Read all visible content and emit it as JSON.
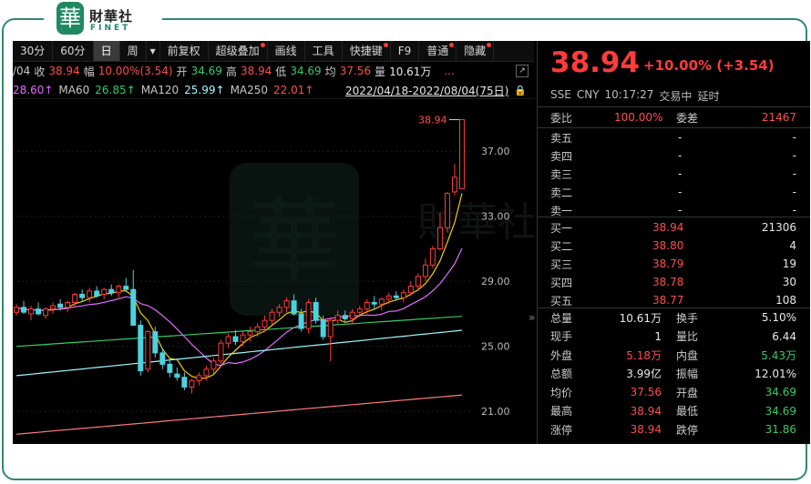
{
  "brand": {
    "badge": "華",
    "name": "財華社",
    "sub": "FINET"
  },
  "toolbar": {
    "items": [
      "30分",
      "60分",
      "日",
      "周",
      "▾",
      "前复权",
      "超级叠加",
      "画线",
      "工具",
      "快捷键",
      "F9",
      "普通",
      "隐藏"
    ],
    "active": "日"
  },
  "quote": {
    "date": "/04",
    "close_label": "收",
    "close": "38.94",
    "range_label": "幅",
    "range": "10.00%(3.54)",
    "open_label": "开",
    "open": "34.69",
    "high_label": "高",
    "high": "38.94",
    "low_label": "低",
    "low": "34.69",
    "avg_label": "均",
    "avg": "37.56",
    "vol_label": "量",
    "vol": "10.61万",
    "more": "..."
  },
  "ma": {
    "ma_first": "28.60↑",
    "ma60_label": "MA60",
    "ma60": "26.85↑",
    "ma120_label": "MA120",
    "ma120": "25.99↑",
    "ma250_label": "MA250",
    "ma250": "22.01↑",
    "date_range": "2022/04/18-2022/08/04(75日)"
  },
  "chart_data": {
    "type": "candlestick",
    "y_ticks": [
      "37.00",
      "33.00",
      "29.00",
      "25.00",
      "21.00"
    ],
    "ylim": [
      19.0,
      40.2
    ],
    "last_price_label": "38.94",
    "candles": [
      [
        27.1,
        27.6,
        26.9,
        27.4
      ],
      [
        27.4,
        27.8,
        27.0,
        27.1
      ],
      [
        27.0,
        27.5,
        26.6,
        27.3
      ],
      [
        27.3,
        27.7,
        26.9,
        27.0
      ],
      [
        26.9,
        27.4,
        26.7,
        27.3
      ],
      [
        27.3,
        27.7,
        27.0,
        27.5
      ],
      [
        27.6,
        27.9,
        27.2,
        27.4
      ],
      [
        27.4,
        27.8,
        27.1,
        27.7
      ],
      [
        27.7,
        28.3,
        27.4,
        28.2
      ],
      [
        28.2,
        28.5,
        27.8,
        28.0
      ],
      [
        28.0,
        28.6,
        27.7,
        28.4
      ],
      [
        28.4,
        28.7,
        28.0,
        28.1
      ],
      [
        28.2,
        28.6,
        27.9,
        28.5
      ],
      [
        28.5,
        28.8,
        28.1,
        28.3
      ],
      [
        28.3,
        28.8,
        28.0,
        28.7
      ],
      [
        28.7,
        29.2,
        28.4,
        28.5
      ],
      [
        28.5,
        29.7,
        28.2,
        26.3
      ],
      [
        26.3,
        26.6,
        23.2,
        23.5
      ],
      [
        23.6,
        26.0,
        23.4,
        25.9
      ],
      [
        25.9,
        26.2,
        24.3,
        24.6
      ],
      [
        24.6,
        24.9,
        23.6,
        23.9
      ],
      [
        23.9,
        24.3,
        23.1,
        23.4
      ],
      [
        23.3,
        23.7,
        22.9,
        23.1
      ],
      [
        23.1,
        23.4,
        22.3,
        22.5
      ],
      [
        22.5,
        23.0,
        22.1,
        22.9
      ],
      [
        22.9,
        23.4,
        22.6,
        23.2
      ],
      [
        23.2,
        23.8,
        22.9,
        23.6
      ],
      [
        23.6,
        24.3,
        23.3,
        24.1
      ],
      [
        24.1,
        25.4,
        23.9,
        25.2
      ],
      [
        25.2,
        25.8,
        24.9,
        25.6
      ],
      [
        25.6,
        26.0,
        25.1,
        25.3
      ],
      [
        25.3,
        25.9,
        25.0,
        25.7
      ],
      [
        25.7,
        26.2,
        25.3,
        25.9
      ],
      [
        25.9,
        26.4,
        25.6,
        26.2
      ],
      [
        26.2,
        26.9,
        25.9,
        26.6
      ],
      [
        26.6,
        27.3,
        26.3,
        27.1
      ],
      [
        27.1,
        27.6,
        26.8,
        27.4
      ],
      [
        27.4,
        28.0,
        27.1,
        27.8
      ],
      [
        27.8,
        28.2,
        26.9,
        27.0
      ],
      [
        27.0,
        27.3,
        25.9,
        26.1
      ],
      [
        26.1,
        27.9,
        25.8,
        27.7
      ],
      [
        27.7,
        28.0,
        26.4,
        26.6
      ],
      [
        26.6,
        26.9,
        25.4,
        25.6
      ],
      [
        25.6,
        26.8,
        24.1,
        26.6
      ],
      [
        26.6,
        27.2,
        26.3,
        26.9
      ],
      [
        26.9,
        27.2,
        26.5,
        26.7
      ],
      [
        26.7,
        27.3,
        26.4,
        27.1
      ],
      [
        27.1,
        27.5,
        26.8,
        27.3
      ],
      [
        27.3,
        27.9,
        27.0,
        27.7
      ],
      [
        27.7,
        28.1,
        27.3,
        27.6
      ],
      [
        27.6,
        28.0,
        27.2,
        27.9
      ],
      [
        27.9,
        28.3,
        27.6,
        28.1
      ],
      [
        28.1,
        28.4,
        27.8,
        28.0
      ],
      [
        28.0,
        28.5,
        27.7,
        28.3
      ],
      [
        28.3,
        29.0,
        28.1,
        28.7
      ],
      [
        28.7,
        29.5,
        28.4,
        29.3
      ],
      [
        29.3,
        30.4,
        29.0,
        30.0
      ],
      [
        30.0,
        31.2,
        29.8,
        31.0
      ],
      [
        31.0,
        33.2,
        30.9,
        32.3
      ],
      [
        32.3,
        34.5,
        32.0,
        34.4
      ],
      [
        34.5,
        36.2,
        34.3,
        35.4
      ],
      [
        34.7,
        38.94,
        34.69,
        38.94
      ]
    ],
    "ma_colors": [
      "#f0d000",
      "#e36cff",
      "#33cc66",
      "#9ff7ff",
      "#ff7a7a"
    ]
  },
  "side": {
    "price": "38.94",
    "change": "+10.00% (+3.54)",
    "exchange": "SSE",
    "currency": "CNY",
    "time": "10:17:27",
    "status": "交易中",
    "delay": "延时",
    "ratio_label": "委比",
    "ratio": "100.00%",
    "diff_label": "委差",
    "diff": "21467",
    "asks": [
      {
        "label": "卖五",
        "price": "-",
        "vol": "-"
      },
      {
        "label": "卖四",
        "price": "-",
        "vol": "-"
      },
      {
        "label": "卖三",
        "price": "-",
        "vol": "-"
      },
      {
        "label": "卖二",
        "price": "-",
        "vol": "-"
      },
      {
        "label": "卖一",
        "price": "-",
        "vol": "-"
      }
    ],
    "bids": [
      {
        "label": "买一",
        "price": "38.94",
        "vol": "21306"
      },
      {
        "label": "买二",
        "price": "38.80",
        "vol": "4"
      },
      {
        "label": "买三",
        "price": "38.79",
        "vol": "19"
      },
      {
        "label": "买四",
        "price": "38.78",
        "vol": "30"
      },
      {
        "label": "买五",
        "price": "38.77",
        "vol": "108"
      }
    ],
    "stats": [
      {
        "l1": "总量",
        "v1": "10.61万",
        "c1": "white",
        "l2": "换手",
        "v2": "5.10%",
        "c2": "white"
      },
      {
        "l1": "现手",
        "v1": "1",
        "c1": "white",
        "l2": "量比",
        "v2": "6.44",
        "c2": "white"
      },
      {
        "l1": "外盘",
        "v1": "5.18万",
        "c1": "red",
        "l2": "内盘",
        "v2": "5.43万",
        "c2": "green"
      },
      {
        "l1": "总额",
        "v1": "3.99亿",
        "c1": "white",
        "l2": "振幅",
        "v2": "12.01%",
        "c2": "white"
      },
      {
        "l1": "均价",
        "v1": "37.56",
        "c1": "red",
        "l2": "开盘",
        "v2": "34.69",
        "c2": "green"
      },
      {
        "l1": "最高",
        "v1": "38.94",
        "c1": "red",
        "l2": "最低",
        "v2": "34.69",
        "c2": "green"
      },
      {
        "l1": "涨停",
        "v1": "38.94",
        "c1": "red",
        "l2": "跌停",
        "v2": "31.86",
        "c2": "green"
      }
    ],
    "collapse": "»"
  }
}
